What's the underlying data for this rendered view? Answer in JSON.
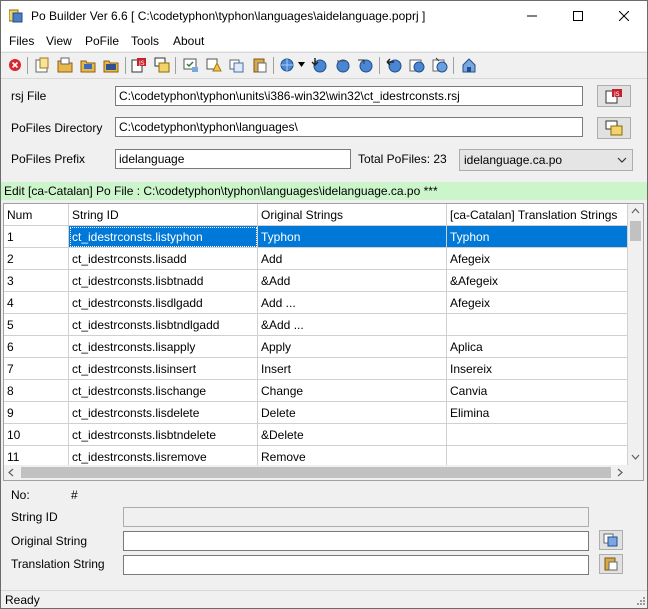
{
  "window": {
    "title": "Po Builder Ver 6.6  [ C:\\codetyphon\\typhon\\languages\\aidelanguage.poprj ]"
  },
  "menu": [
    "Files",
    "View",
    "PoFile",
    "Tools",
    "About"
  ],
  "form": {
    "rsj_label": "rsj File",
    "rsj_value": "C:\\codetyphon\\typhon\\units\\i386-win32\\win32\\ct_idestrconsts.rsj",
    "pofiles_dir_label": "PoFiles Directory",
    "pofiles_dir_value": "C:\\codetyphon\\typhon\\languages\\",
    "prefix_label": "PoFiles Prefix",
    "prefix_value": "idelanguage",
    "total_label": "Total PoFiles: 23",
    "selected_po": "idelanguage.ca.po"
  },
  "edit_status": "Edit [ca-Catalan] Po File : C:\\codetyphon\\typhon\\languages\\idelanguage.ca.po ***",
  "table": {
    "columns": [
      "Num",
      "String ID",
      "Original Strings",
      "[ca-Catalan] Translation Strings"
    ],
    "rows": [
      [
        "1",
        "ct_idestrconsts.listyphon",
        "Typhon",
        "Typhon"
      ],
      [
        "2",
        "ct_idestrconsts.lisadd",
        "Add",
        "Afegeix"
      ],
      [
        "3",
        "ct_idestrconsts.lisbtnadd",
        "&Add",
        "&Afegeix"
      ],
      [
        "4",
        "ct_idestrconsts.lisdlgadd",
        "Add ...",
        "Afegeix"
      ],
      [
        "5",
        "ct_idestrconsts.lisbtndlgadd",
        "&Add ...",
        ""
      ],
      [
        "6",
        "ct_idestrconsts.lisapply",
        "Apply",
        "Aplica"
      ],
      [
        "7",
        "ct_idestrconsts.lisinsert",
        "Insert",
        "Insereix"
      ],
      [
        "8",
        "ct_idestrconsts.lischange",
        "Change",
        "Canvia"
      ],
      [
        "9",
        "ct_idestrconsts.lisdelete",
        "Delete",
        "Elimina"
      ],
      [
        "10",
        "ct_idestrconsts.lisbtndelete",
        "&Delete",
        ""
      ],
      [
        "11",
        "ct_idestrconsts.lisremove",
        "Remove",
        ""
      ]
    ]
  },
  "detail": {
    "no_label": "No:",
    "no_value": "#",
    "string_id_label": "String ID",
    "original_label": "Original String",
    "translation_label": "Translation String"
  },
  "status_bar": "Ready",
  "icons": {
    "title_icon": "app-icon",
    "toolbar": [
      "close-red-icon",
      "new-folder-icon",
      "open-folder-icon",
      "save-icon",
      "save-all-icon",
      "export-icon",
      "import-icon",
      "check-icon",
      "warning-icon",
      "copy-icon",
      "paste-icon",
      "globe-icon",
      "dropdown-arrow-icon",
      "globe-down-icon",
      "globe-up-icon",
      "globe-refresh-icon",
      "arrow-left-icon",
      "world-icon",
      "world-add-icon",
      "house-icon"
    ]
  }
}
